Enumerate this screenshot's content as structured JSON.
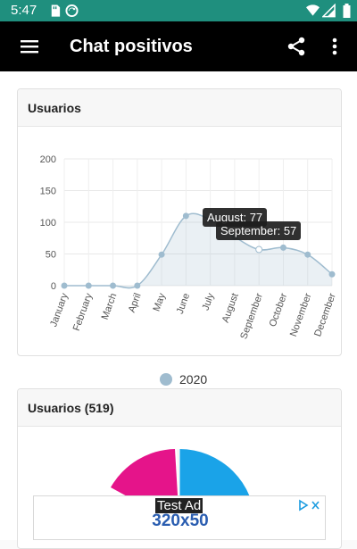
{
  "status_bar": {
    "time": "5:47",
    "icons": [
      "sd-card-icon",
      "sync-icon",
      "wifi-icon",
      "signal-icon",
      "battery-icon"
    ]
  },
  "app_bar": {
    "title": "Chat positivos",
    "icons": [
      "menu-icon",
      "share-icon",
      "more-vert-icon"
    ]
  },
  "cards": {
    "line_title": "Usuarios",
    "pie_title": "Usuarios (519)"
  },
  "tooltips": {
    "august": "August: 77",
    "september": "September: 57"
  },
  "legend": {
    "label": "2020",
    "color": "#9fbccf"
  },
  "ad": {
    "label": "Test Ad",
    "size": "320x50"
  },
  "colors": {
    "status_bar": "#1f8f7e",
    "app_bar": "#000000",
    "series": "#9fbccf",
    "pie_blue": "#1aa3e8",
    "pie_magenta": "#e5148a"
  },
  "chart_data": [
    {
      "type": "line",
      "title": "Usuarios",
      "categories": [
        "January",
        "February",
        "March",
        "April",
        "May",
        "June",
        "July",
        "August",
        "September",
        "October",
        "November",
        "December"
      ],
      "series": [
        {
          "name": "2020",
          "values": [
            0,
            0,
            0,
            0,
            49,
            110,
            104,
            77,
            57,
            60,
            49,
            18
          ]
        }
      ],
      "ylim": [
        0,
        200
      ],
      "yticks": [
        0,
        50,
        100,
        150,
        200
      ],
      "grid": true,
      "legend": "bottom"
    },
    {
      "type": "pie",
      "title": "Usuarios (519)",
      "partial": true
    }
  ]
}
